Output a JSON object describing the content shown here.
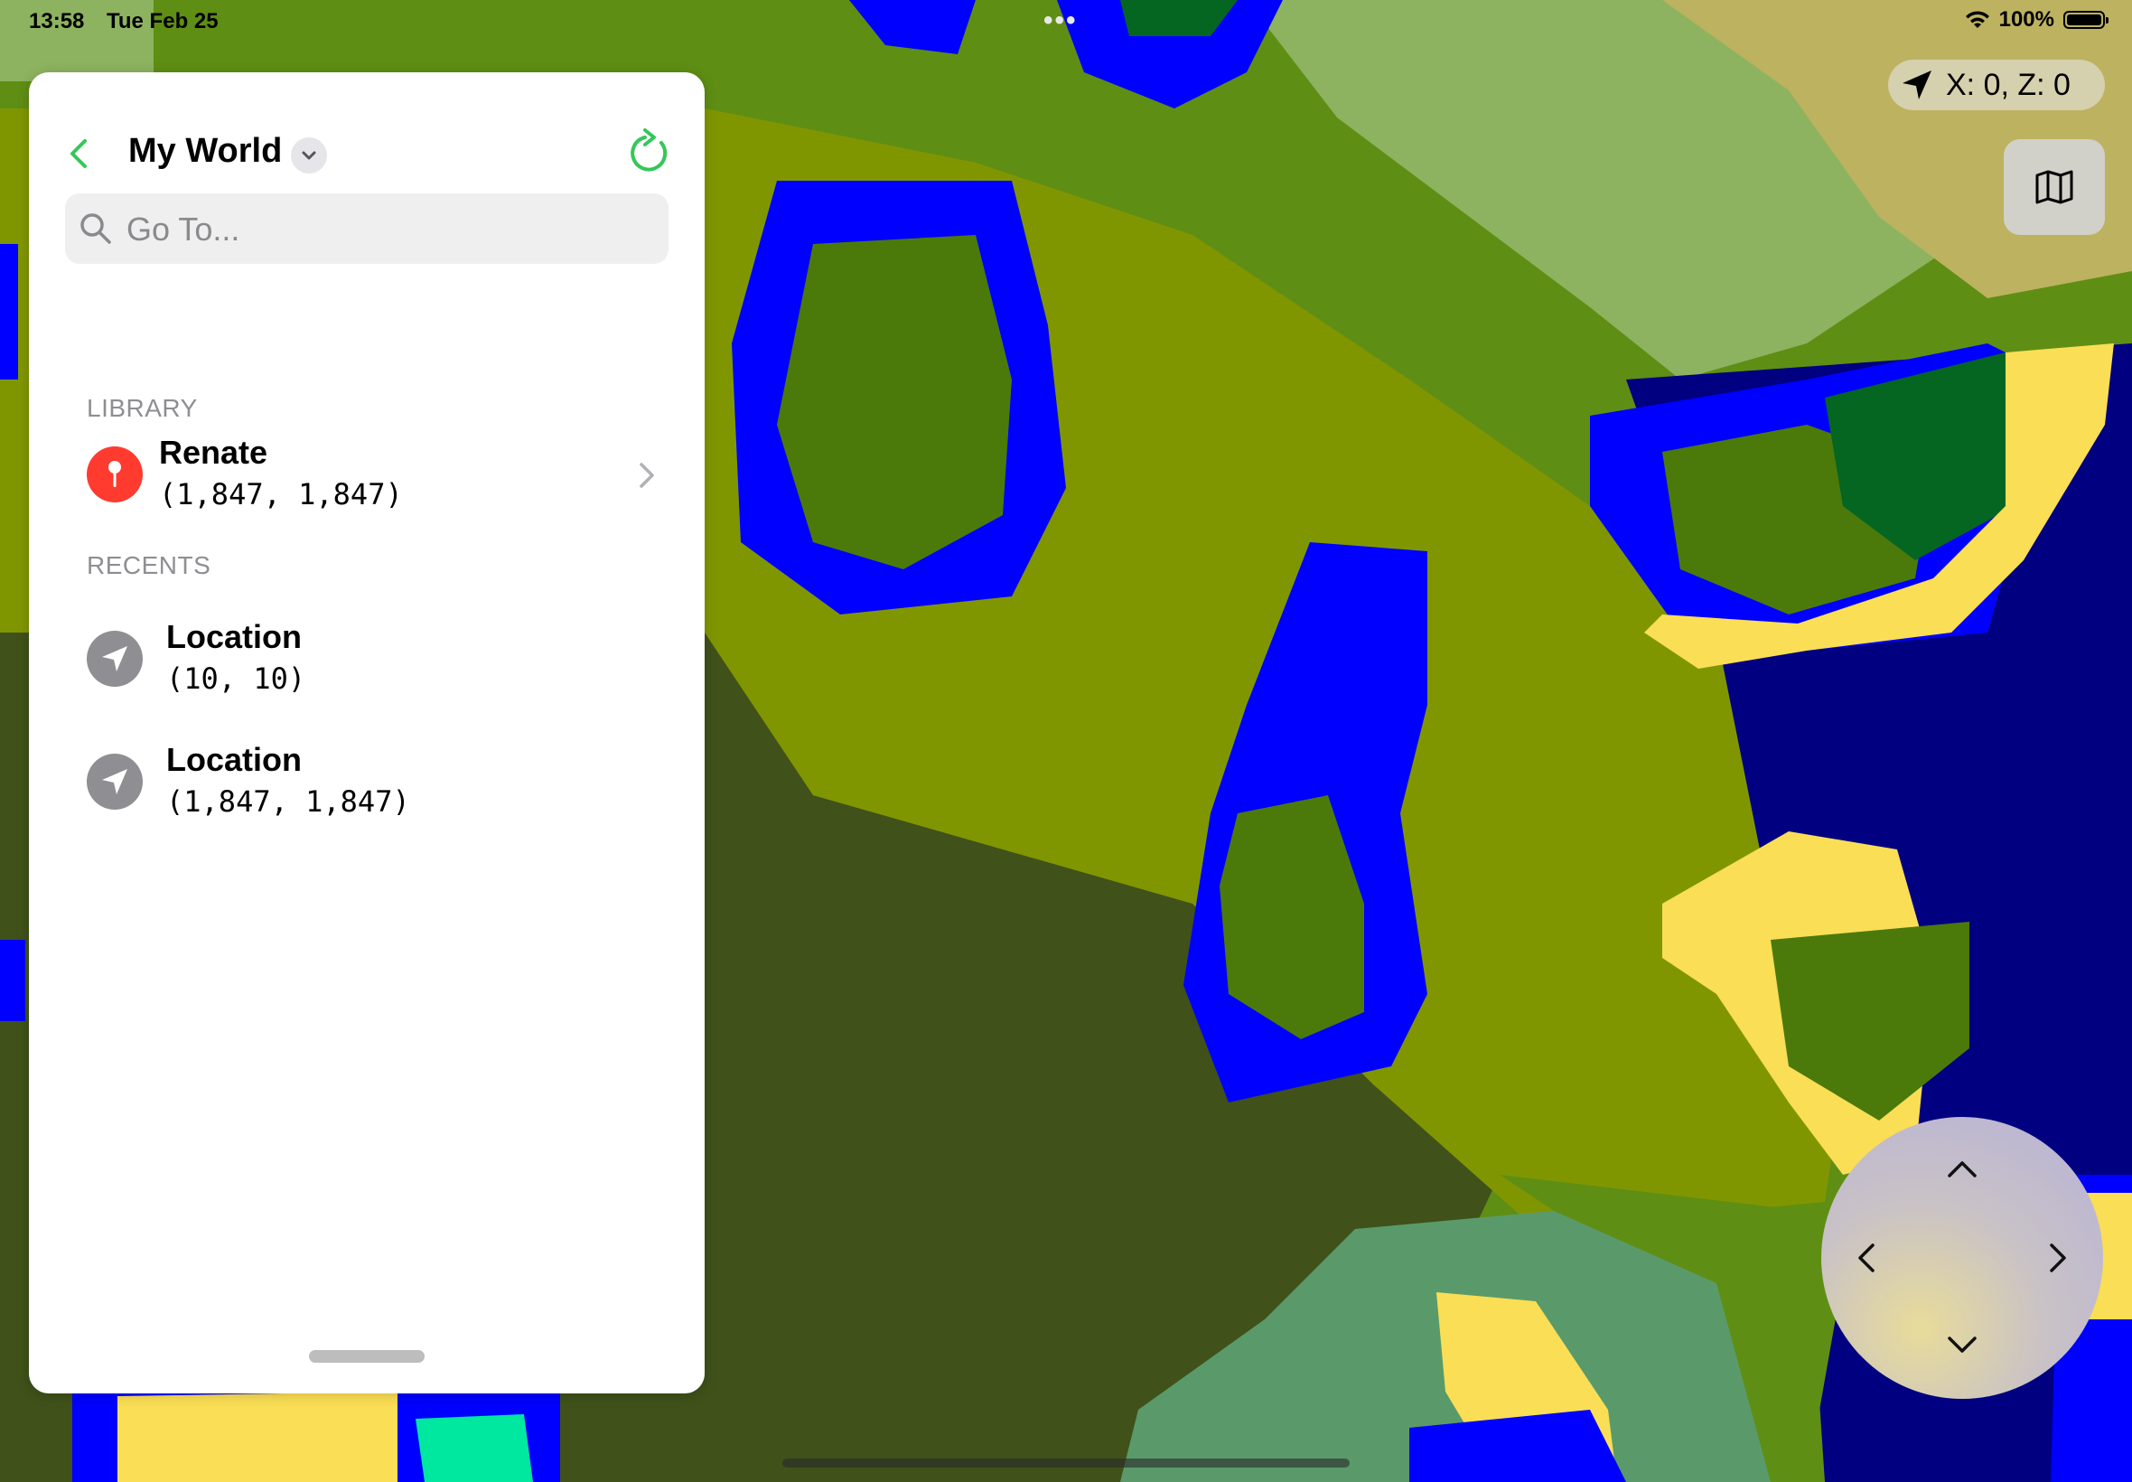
{
  "status_bar": {
    "time": "13:58",
    "date": "Tue Feb 25",
    "multitask_dots": "•••",
    "battery": "100%"
  },
  "sheet": {
    "title": "My World",
    "search": {
      "placeholder": "Go To...",
      "value": ""
    },
    "library": {
      "header": "LIBRARY",
      "items": [
        {
          "name": "Renate",
          "coords": "(1,847, 1,847)",
          "icon": "pin-icon",
          "color": "#ff3b30"
        }
      ]
    },
    "recents": {
      "header": "RECENTS",
      "items": [
        {
          "name": "Location",
          "coords": "(10, 10)",
          "icon": "location-arrow-icon",
          "color": "#8e8e93"
        },
        {
          "name": "Location",
          "coords": "(1,847, 1,847)",
          "icon": "location-arrow-icon",
          "color": "#8e8e93"
        }
      ]
    }
  },
  "map": {
    "coordinate_readout": "X: 0, Z: 0",
    "colors": {
      "water": "#0000ff",
      "deep_ocean": "#000080",
      "beach": "#fade55",
      "plains": "#8db360",
      "forest": "#056621",
      "savanna": "#bdb25f",
      "dark_forest": "#40511a",
      "grass": "#5f8e14",
      "swamp": "#4b7a0a",
      "olive": "#809600"
    }
  },
  "accent": "#34c759"
}
